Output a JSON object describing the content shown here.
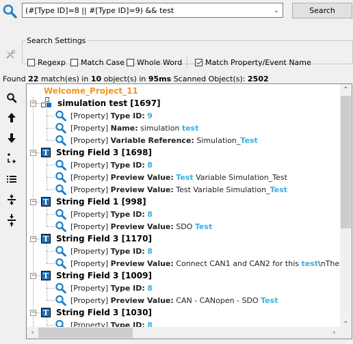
{
  "search": {
    "query": "(#[Type ID]=8 || #[Type ID]=9) && test",
    "button_label": "Search"
  },
  "settings": {
    "legend": "Search Settings",
    "options": [
      {
        "label": "Regexp",
        "checked": false
      },
      {
        "label": "Match Case",
        "checked": false
      },
      {
        "label": "Whole Word",
        "checked": false
      },
      {
        "label": "Match Property/Event Name",
        "checked": true
      }
    ]
  },
  "status": {
    "prefix": "Found",
    "matches": "22",
    "matches_label": "match(es) in",
    "objects": "10",
    "objects_label": "object(s) in",
    "time": "95ms",
    "scanned_label": "Scanned Object(s):",
    "scanned": "2502"
  },
  "toolbar": [
    "search-icon",
    "arrow-up-icon",
    "arrow-down-icon",
    "add-subitem-icon",
    "list-icon",
    "expand-all-icon",
    "collapse-all-icon"
  ],
  "tree": {
    "root": "Welcome_Project_11",
    "nodes": [
      {
        "name": "simulation test [1697]",
        "icon": "variable-icon",
        "props": [
          {
            "prefix": "[Property]",
            "name": "Type ID:",
            "parts": [
              {
                "t": "9",
                "hl": true
              }
            ]
          },
          {
            "prefix": "[Property]",
            "name": "Name:",
            "parts": [
              {
                "t": "simulation ",
                "hl": false
              },
              {
                "t": "test",
                "hl": true
              }
            ]
          },
          {
            "prefix": "[Property]",
            "name": "Variable Reference:",
            "parts": [
              {
                "t": "Simulation_",
                "hl": false
              },
              {
                "t": "Test",
                "hl": true
              }
            ]
          }
        ]
      },
      {
        "name": "String Field 3 [1698]",
        "icon": "text-field-icon",
        "props": [
          {
            "prefix": "[Property]",
            "name": "Type ID:",
            "parts": [
              {
                "t": "8",
                "hl": true
              }
            ]
          },
          {
            "prefix": "[Property]",
            "name": "Preview Value:",
            "parts": [
              {
                "t": "Test",
                "hl": true
              },
              {
                "t": " Variable Simulation_Test",
                "hl": false
              }
            ]
          },
          {
            "prefix": "[Property]",
            "name": "Preview Value:",
            "parts": [
              {
                "t": "Test Variable Simulation_",
                "hl": false
              },
              {
                "t": "Test",
                "hl": true
              }
            ]
          }
        ]
      },
      {
        "name": "String Field 1 [998]",
        "icon": "text-field-icon",
        "props": [
          {
            "prefix": "[Property]",
            "name": "Type ID:",
            "parts": [
              {
                "t": "8",
                "hl": true
              }
            ]
          },
          {
            "prefix": "[Property]",
            "name": "Preview Value:",
            "parts": [
              {
                "t": "SDO ",
                "hl": false
              },
              {
                "t": "Test",
                "hl": true
              }
            ]
          }
        ]
      },
      {
        "name": "String Field 3 [1170]",
        "icon": "text-field-icon",
        "props": [
          {
            "prefix": "[Property]",
            "name": "Type ID:",
            "parts": [
              {
                "t": "8",
                "hl": true
              }
            ]
          },
          {
            "prefix": "[Property]",
            "name": "Preview Value:",
            "parts": [
              {
                "t": "Connect CAN1 and CAN2 for this ",
                "hl": false
              },
              {
                "t": "test",
                "hl": true
              },
              {
                "t": "\\nThe ECU will",
                "hl": false
              }
            ]
          }
        ]
      },
      {
        "name": "String Field 3 [1009]",
        "icon": "text-field-icon",
        "props": [
          {
            "prefix": "[Property]",
            "name": "Type ID:",
            "parts": [
              {
                "t": "8",
                "hl": true
              }
            ]
          },
          {
            "prefix": "[Property]",
            "name": "Preview Value:",
            "parts": [
              {
                "t": "CAN - CANopen - SDO ",
                "hl": false
              },
              {
                "t": "Test",
                "hl": true
              }
            ]
          }
        ]
      },
      {
        "name": "String Field 3 [1030]",
        "icon": "text-field-icon",
        "props": [
          {
            "prefix": "[Property]",
            "name": "Type ID:",
            "parts": [
              {
                "t": "8",
                "hl": true
              }
            ]
          }
        ]
      }
    ]
  }
}
